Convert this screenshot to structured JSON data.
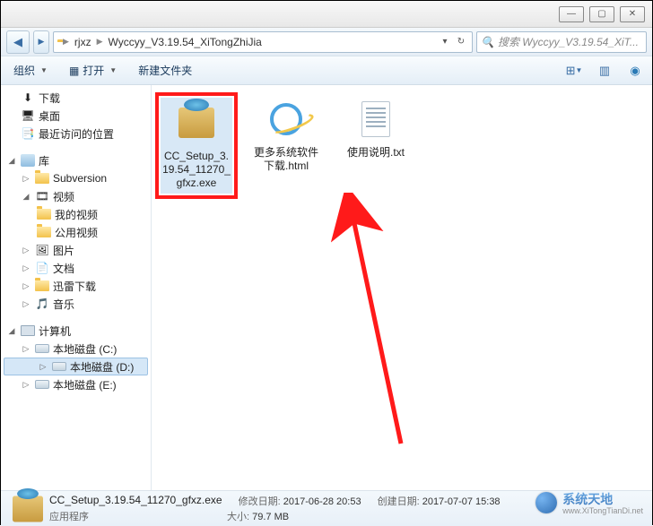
{
  "titlebar": {
    "minimize": "—",
    "maximize": "▢",
    "close": "✕"
  },
  "address": {
    "back": "◀",
    "forward": "▶",
    "segments": [
      "rjxz",
      "Wyccyy_V3.19.54_XiTongZhiJia"
    ],
    "refresh": "↻",
    "search_placeholder": "搜索 Wyccyy_V3.19.54_XiT..."
  },
  "toolbar": {
    "organize": "组织",
    "open": "打开",
    "new_folder": "新建文件夹"
  },
  "nav": {
    "downloads": "下载",
    "desktop": "桌面",
    "recent": "最近访问的位置",
    "libraries": "库",
    "subversion": "Subversion",
    "videos": "视频",
    "my_videos": "我的视频",
    "public_videos": "公用视频",
    "pictures": "图片",
    "documents": "文档",
    "xunlei": "迅雷下载",
    "music": "音乐",
    "computer": "计算机",
    "drive_c": "本地磁盘 (C:)",
    "drive_d": "本地磁盘 (D:)",
    "drive_e": "本地磁盘 (E:)"
  },
  "files": [
    {
      "name": "CC_Setup_3.19.54_11270_gfxz.exe",
      "type": "exe",
      "highlighted": true
    },
    {
      "name": "更多系统软件下载.html",
      "type": "html",
      "highlighted": false
    },
    {
      "name": "使用说明.txt",
      "type": "txt",
      "highlighted": false
    }
  ],
  "details": {
    "filename": "CC_Setup_3.19.54_11270_gfxz.exe",
    "filetype": "应用程序",
    "mod_label": "修改日期:",
    "mod_value": "2017-06-28 20:53",
    "size_label": "大小:",
    "size_value": "79.7 MB",
    "create_label": "创建日期:",
    "create_value": "2017-07-07 15:38"
  },
  "watermark": {
    "brand": "系统天地",
    "url": "www.XiTongTianDi.net"
  }
}
